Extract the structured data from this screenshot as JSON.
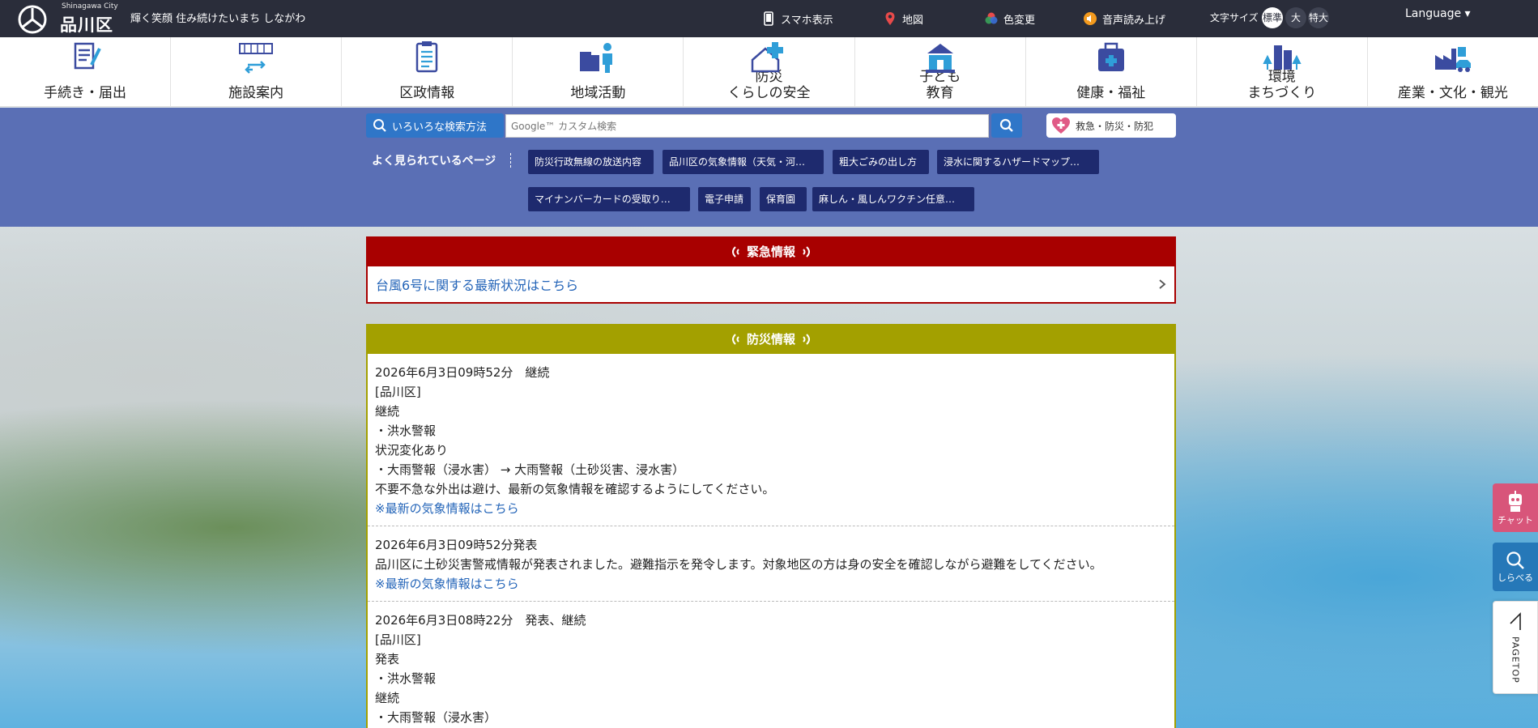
{
  "header": {
    "logo_en": "Shinagawa City",
    "logo_ja": "品川区",
    "tagline": "輝く笑顔 住み続けたいまち しながわ",
    "links": {
      "smartphone": "スマホ表示",
      "map": "地図",
      "color": "色変更",
      "voice": "音声読み上げ"
    },
    "font_size_label": "文字サイズ",
    "font_sizes": [
      "標準",
      "大",
      "特大"
    ],
    "language": "Language ▾"
  },
  "nav": [
    {
      "label": "手続き・届出",
      "icon": "pen-document-icon"
    },
    {
      "label": "施設案内",
      "icon": "building-arrows-icon"
    },
    {
      "label": "区政情報",
      "icon": "clipboard-icon"
    },
    {
      "label": "地域活動",
      "icon": "community-icon"
    },
    {
      "label": "防災\nくらしの安全",
      "icon": "house-cross-icon"
    },
    {
      "label": "子ども\n教育",
      "icon": "school-icon"
    },
    {
      "label": "健康・福祉",
      "icon": "medical-bag-icon"
    },
    {
      "label": "環境\nまちづくり",
      "icon": "city-trees-icon"
    },
    {
      "label": "産業・文化・観光",
      "icon": "factory-icon"
    }
  ],
  "search": {
    "method_label": "いろいろな検索方法",
    "placeholder": "Google™ カスタム検索",
    "emergency_label": "救急・防災・防犯"
  },
  "popular": {
    "label": "よく見られているページ",
    "tags": [
      "防災行政無線の放送内容",
      "品川区の気象情報（天気・河…",
      "粗大ごみの出し方",
      "浸水に関するハザードマップ…",
      "マイナンバーカードの受取り…",
      "電子申請",
      "保育園",
      "麻しん・風しんワクチン任意…"
    ]
  },
  "emergency": {
    "title": "緊急情報",
    "link": "台風6号に関する最新状況はこちら"
  },
  "bosai": {
    "title": "防災情報",
    "entries": [
      {
        "lines": [
          "2026年6月3日09時52分　継続",
          "[品川区]",
          "継続",
          "・洪水警報",
          "状況変化あり",
          "・大雨警報（浸水害） → 大雨警報（土砂災害、浸水害）",
          "不要不急な外出は避け、最新の気象情報を確認するようにしてください。"
        ],
        "link": "※最新の気象情報はこちら"
      },
      {
        "lines": [
          "2026年6月3日09時52分発表",
          "品川区に土砂災害警戒情報が発表されました。避難指示を発令します。対象地区の方は身の安全を確認しながら避難をしてください。"
        ],
        "link": "※最新の気象情報はこちら"
      },
      {
        "lines": [
          "2026年6月3日08時22分　発表、継続",
          "[品川区]",
          "発表",
          "・洪水警報",
          "継続",
          "・大雨警報（浸水害）"
        ],
        "link": ""
      }
    ]
  },
  "side": {
    "chat": "チャット",
    "search": "しらべる",
    "pagetop": "PAGETOP"
  }
}
